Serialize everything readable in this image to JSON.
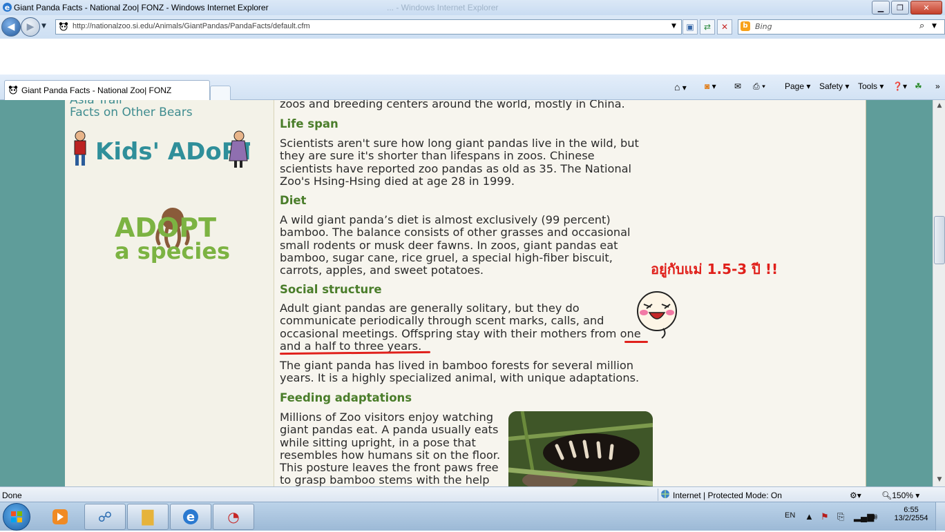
{
  "window": {
    "title": "Giant Panda Facts - National Zoo| FONZ - Windows Internet Explorer",
    "ghost_title": "... - Windows Internet Explorer"
  },
  "nav": {
    "url": "http://nationalzoo.si.edu/Animals/GiantPandas/PandaFacts/default.cfm",
    "search_placeholder": "Bing"
  },
  "tab": {
    "label": "Giant Panda Facts - National Zoo| FONZ"
  },
  "commands": {
    "page": "Page",
    "safety": "Safety",
    "tools": "Tools"
  },
  "sidebar": {
    "links": [
      "Asia Trail",
      "Facts on Other Bears"
    ],
    "kids_adopt": "Kids' ADoPT",
    "adopt_species_line1": "ADOPT",
    "adopt_species_line2": "a species"
  },
  "article": {
    "intro_tail": "zoos and breeding centers around the world, mostly in China.",
    "sections": [
      {
        "heading": "Life span",
        "text": [
          "Scientists aren't sure how long giant pandas live in the wild, but",
          "they are sure it's shorter than lifespans in zoos. Chinese",
          "scientists have reported zoo pandas as old as 35. The National",
          "Zoo's Hsing-Hsing died at age 28 in 1999."
        ]
      },
      {
        "heading": "Diet",
        "text": [
          "A wild giant panda’s diet is almost exclusively (99 percent)",
          "bamboo. The balance consists of other grasses and occasional",
          "small rodents or musk deer fawns. In zoos, giant pandas eat",
          "bamboo, sugar cane, rice gruel, a special high-fiber biscuit,",
          "carrots, apples, and sweet potatoes."
        ]
      },
      {
        "heading": "Social structure",
        "text": [
          "Adult giant pandas are generally solitary, but they do",
          "communicate periodically through scent marks, calls, and",
          "occasional meetings. Offspring stay with their mothers from one",
          "and a half to three years."
        ]
      },
      {
        "heading": "",
        "text": [
          "The giant panda has lived in bamboo forests for several million",
          "years. It is a highly specialized animal, with unique adaptations."
        ]
      },
      {
        "heading": "Feeding adaptations",
        "text": [
          "Millions of Zoo visitors enjoy watching",
          "giant pandas eat. A panda usually eats",
          "while sitting upright, in a pose that",
          "resembles how humans sit on the floor.",
          "This posture leaves the front paws free",
          "to grasp bamboo stems with the help"
        ]
      }
    ]
  },
  "annotation": {
    "thai_text": "อยู่กับแม่  1.5-3  ปี  !!",
    "color": "#e0201b"
  },
  "status": {
    "left": "Done",
    "zone": "Internet | Protected Mode: On",
    "zoom": "150%"
  },
  "taskbar": {
    "lang": "EN",
    "time": "6:55",
    "date": "13/2/2554"
  }
}
